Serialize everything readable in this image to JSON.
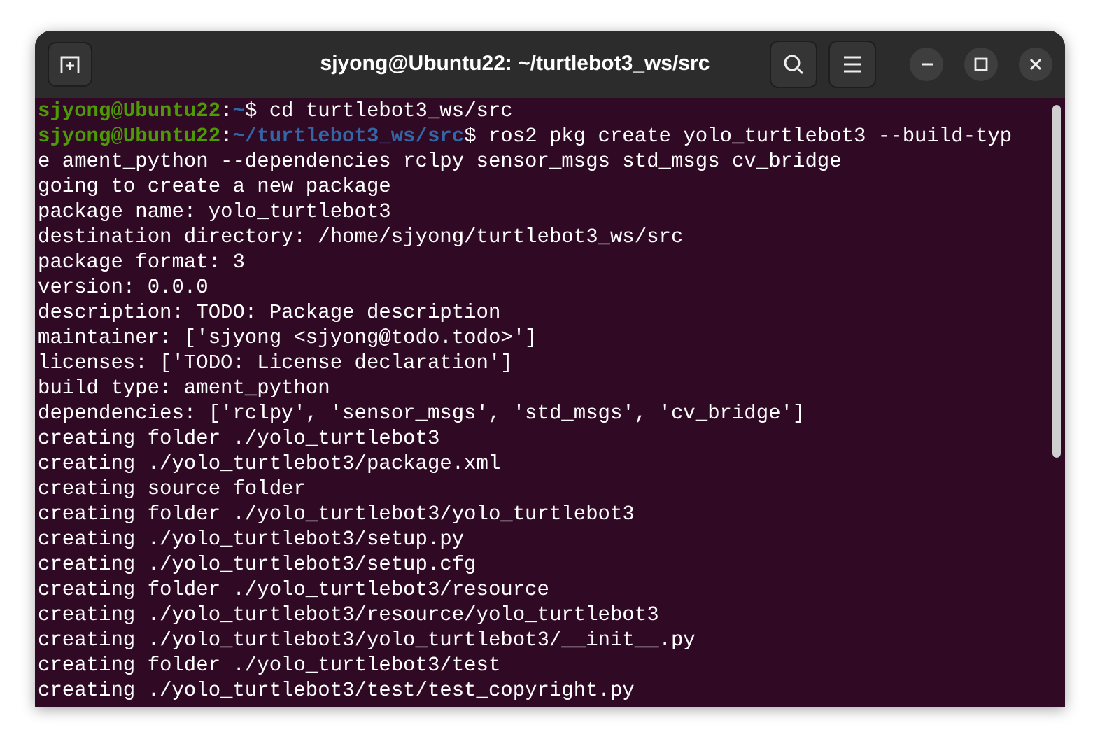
{
  "window": {
    "title": "sjyong@Ubuntu22: ~/turtlebot3_ws/src"
  },
  "terminal": {
    "lines": [
      {
        "kind": "prompt",
        "user": "sjyong@Ubuntu22",
        "colon": ":",
        "path": "~",
        "symbol": "$",
        "command": "cd turtlebot3_ws/src"
      },
      {
        "kind": "prompt",
        "user": "sjyong@Ubuntu22",
        "colon": ":",
        "path": "~/turtlebot3_ws/src",
        "symbol": "$",
        "command": "ros2 pkg create yolo_turtlebot3 --build-typ"
      },
      {
        "kind": "output",
        "text": "e ament_python --dependencies rclpy sensor_msgs std_msgs cv_bridge"
      },
      {
        "kind": "output",
        "text": "going to create a new package"
      },
      {
        "kind": "output",
        "text": "package name: yolo_turtlebot3"
      },
      {
        "kind": "output",
        "text": "destination directory: /home/sjyong/turtlebot3_ws/src"
      },
      {
        "kind": "output",
        "text": "package format: 3"
      },
      {
        "kind": "output",
        "text": "version: 0.0.0"
      },
      {
        "kind": "output",
        "text": "description: TODO: Package description"
      },
      {
        "kind": "output",
        "text": "maintainer: ['sjyong <sjyong@todo.todo>']"
      },
      {
        "kind": "output",
        "text": "licenses: ['TODO: License declaration']"
      },
      {
        "kind": "output",
        "text": "build type: ament_python"
      },
      {
        "kind": "output",
        "text": "dependencies: ['rclpy', 'sensor_msgs', 'std_msgs', 'cv_bridge']"
      },
      {
        "kind": "output",
        "text": "creating folder ./yolo_turtlebot3"
      },
      {
        "kind": "output",
        "text": "creating ./yolo_turtlebot3/package.xml"
      },
      {
        "kind": "output",
        "text": "creating source folder"
      },
      {
        "kind": "output",
        "text": "creating folder ./yolo_turtlebot3/yolo_turtlebot3"
      },
      {
        "kind": "output",
        "text": "creating ./yolo_turtlebot3/setup.py"
      },
      {
        "kind": "output",
        "text": "creating ./yolo_turtlebot3/setup.cfg"
      },
      {
        "kind": "output",
        "text": "creating folder ./yolo_turtlebot3/resource"
      },
      {
        "kind": "output",
        "text": "creating ./yolo_turtlebot3/resource/yolo_turtlebot3"
      },
      {
        "kind": "output",
        "text": "creating ./yolo_turtlebot3/yolo_turtlebot3/__init__.py"
      },
      {
        "kind": "output",
        "text": "creating folder ./yolo_turtlebot3/test"
      },
      {
        "kind": "output",
        "text": "creating ./yolo_turtlebot3/test/test_copyright.py"
      }
    ]
  }
}
